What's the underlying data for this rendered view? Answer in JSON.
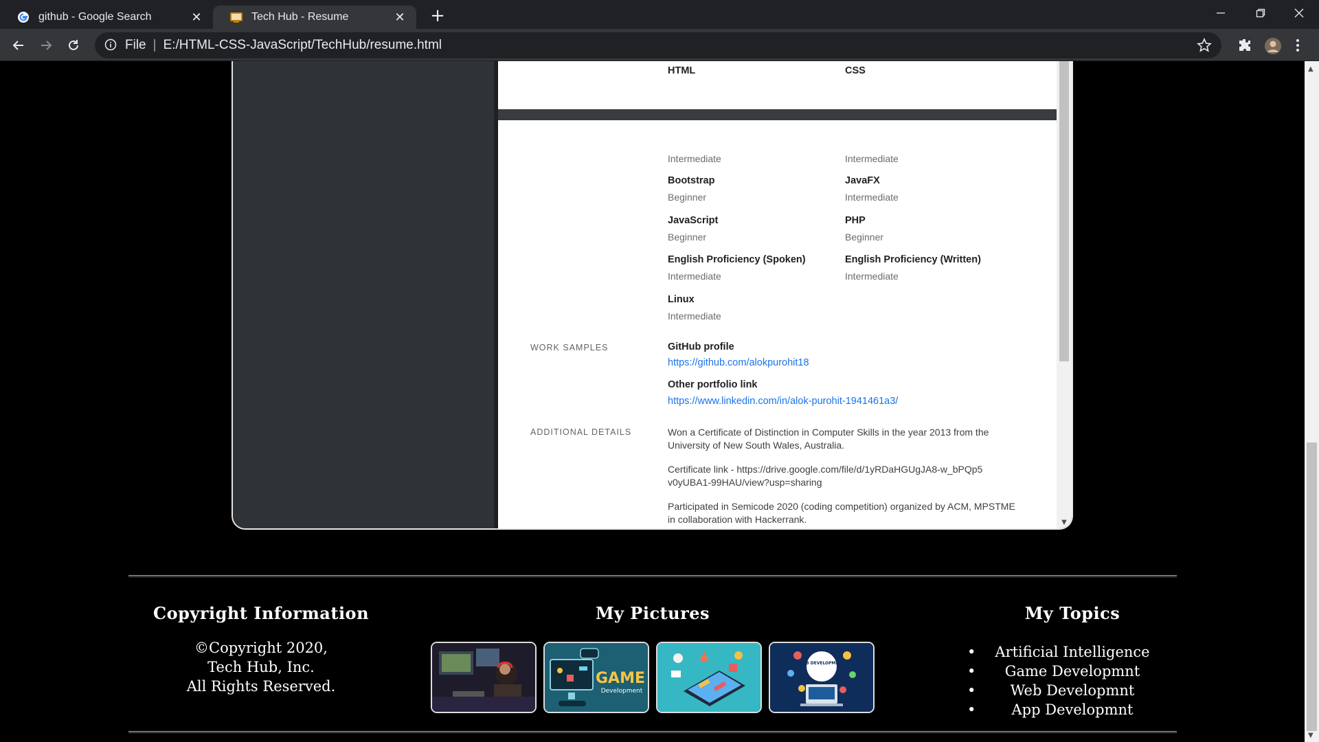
{
  "browser": {
    "tabs": [
      {
        "title": "github - Google Search",
        "active": false,
        "favicon": "google-g-icon"
      },
      {
        "title": "Tech Hub - Resume",
        "active": true,
        "favicon": "techhub-icon"
      }
    ],
    "omnibox": {
      "scheme": "File",
      "separator": "|",
      "url": "E:/HTML-CSS-JavaScript/TechHub/resume.html"
    }
  },
  "resume": {
    "top_skills": [
      {
        "name": "HTML"
      },
      {
        "name": "CSS"
      }
    ],
    "skills": [
      {
        "name": "",
        "level": "Intermediate"
      },
      {
        "name": "",
        "level": "Intermediate"
      },
      {
        "name": "Bootstrap",
        "level": "Beginner"
      },
      {
        "name": "JavaFX",
        "level": "Intermediate"
      },
      {
        "name": "JavaScript",
        "level": "Beginner"
      },
      {
        "name": "PHP",
        "level": "Beginner"
      },
      {
        "name": "English Proficiency (Spoken)",
        "level": "Intermediate"
      },
      {
        "name": "English Proficiency (Written)",
        "level": "Intermediate"
      },
      {
        "name": "Linux",
        "level": "Intermediate"
      }
    ],
    "work_samples": {
      "label": "WORK SAMPLES",
      "github_title": "GitHub profile",
      "github_url": "https://github.com/alokpurohit18",
      "portfolio_title": "Other portfolio link",
      "portfolio_url": "https://www.linkedin.com/in/alok-purohit-1941461a3/"
    },
    "additional": {
      "label": "ADDITIONAL DETAILS",
      "para1": "Won a Certificate of Distinction in Computer Skills in the year 2013 from the University of New South Wales, Australia.",
      "para2": "Certificate link - https://drive.google.com/file/d/1yRDaHGUgJA8-w_bPQp5v0yUBA1-99HAU/view?usp=sharing",
      "para3": "Participated in Semicode 2020 (coding competition) organized by ACM, MPSTME in collaboration with Hackerrank."
    }
  },
  "footer": {
    "copyright": {
      "heading": "Copyright Information",
      "line1": "©Copyright 2020,",
      "line2": "Tech Hub, Inc.",
      "line3": "All Rights Reserved."
    },
    "pictures": {
      "heading": "My Pictures",
      "game_text": "GAME",
      "game_sub": "Development",
      "web_text": "WEB DEVELOPMENT"
    },
    "topics": {
      "heading": "My Topics",
      "items": [
        "Artificial Intelligence",
        "Game Developmnt",
        "Web Developmnt",
        "App Developmnt"
      ]
    }
  },
  "colors": {
    "link": "#1a73e8",
    "page_bg": "#000000",
    "panel_bg": "#303336"
  }
}
